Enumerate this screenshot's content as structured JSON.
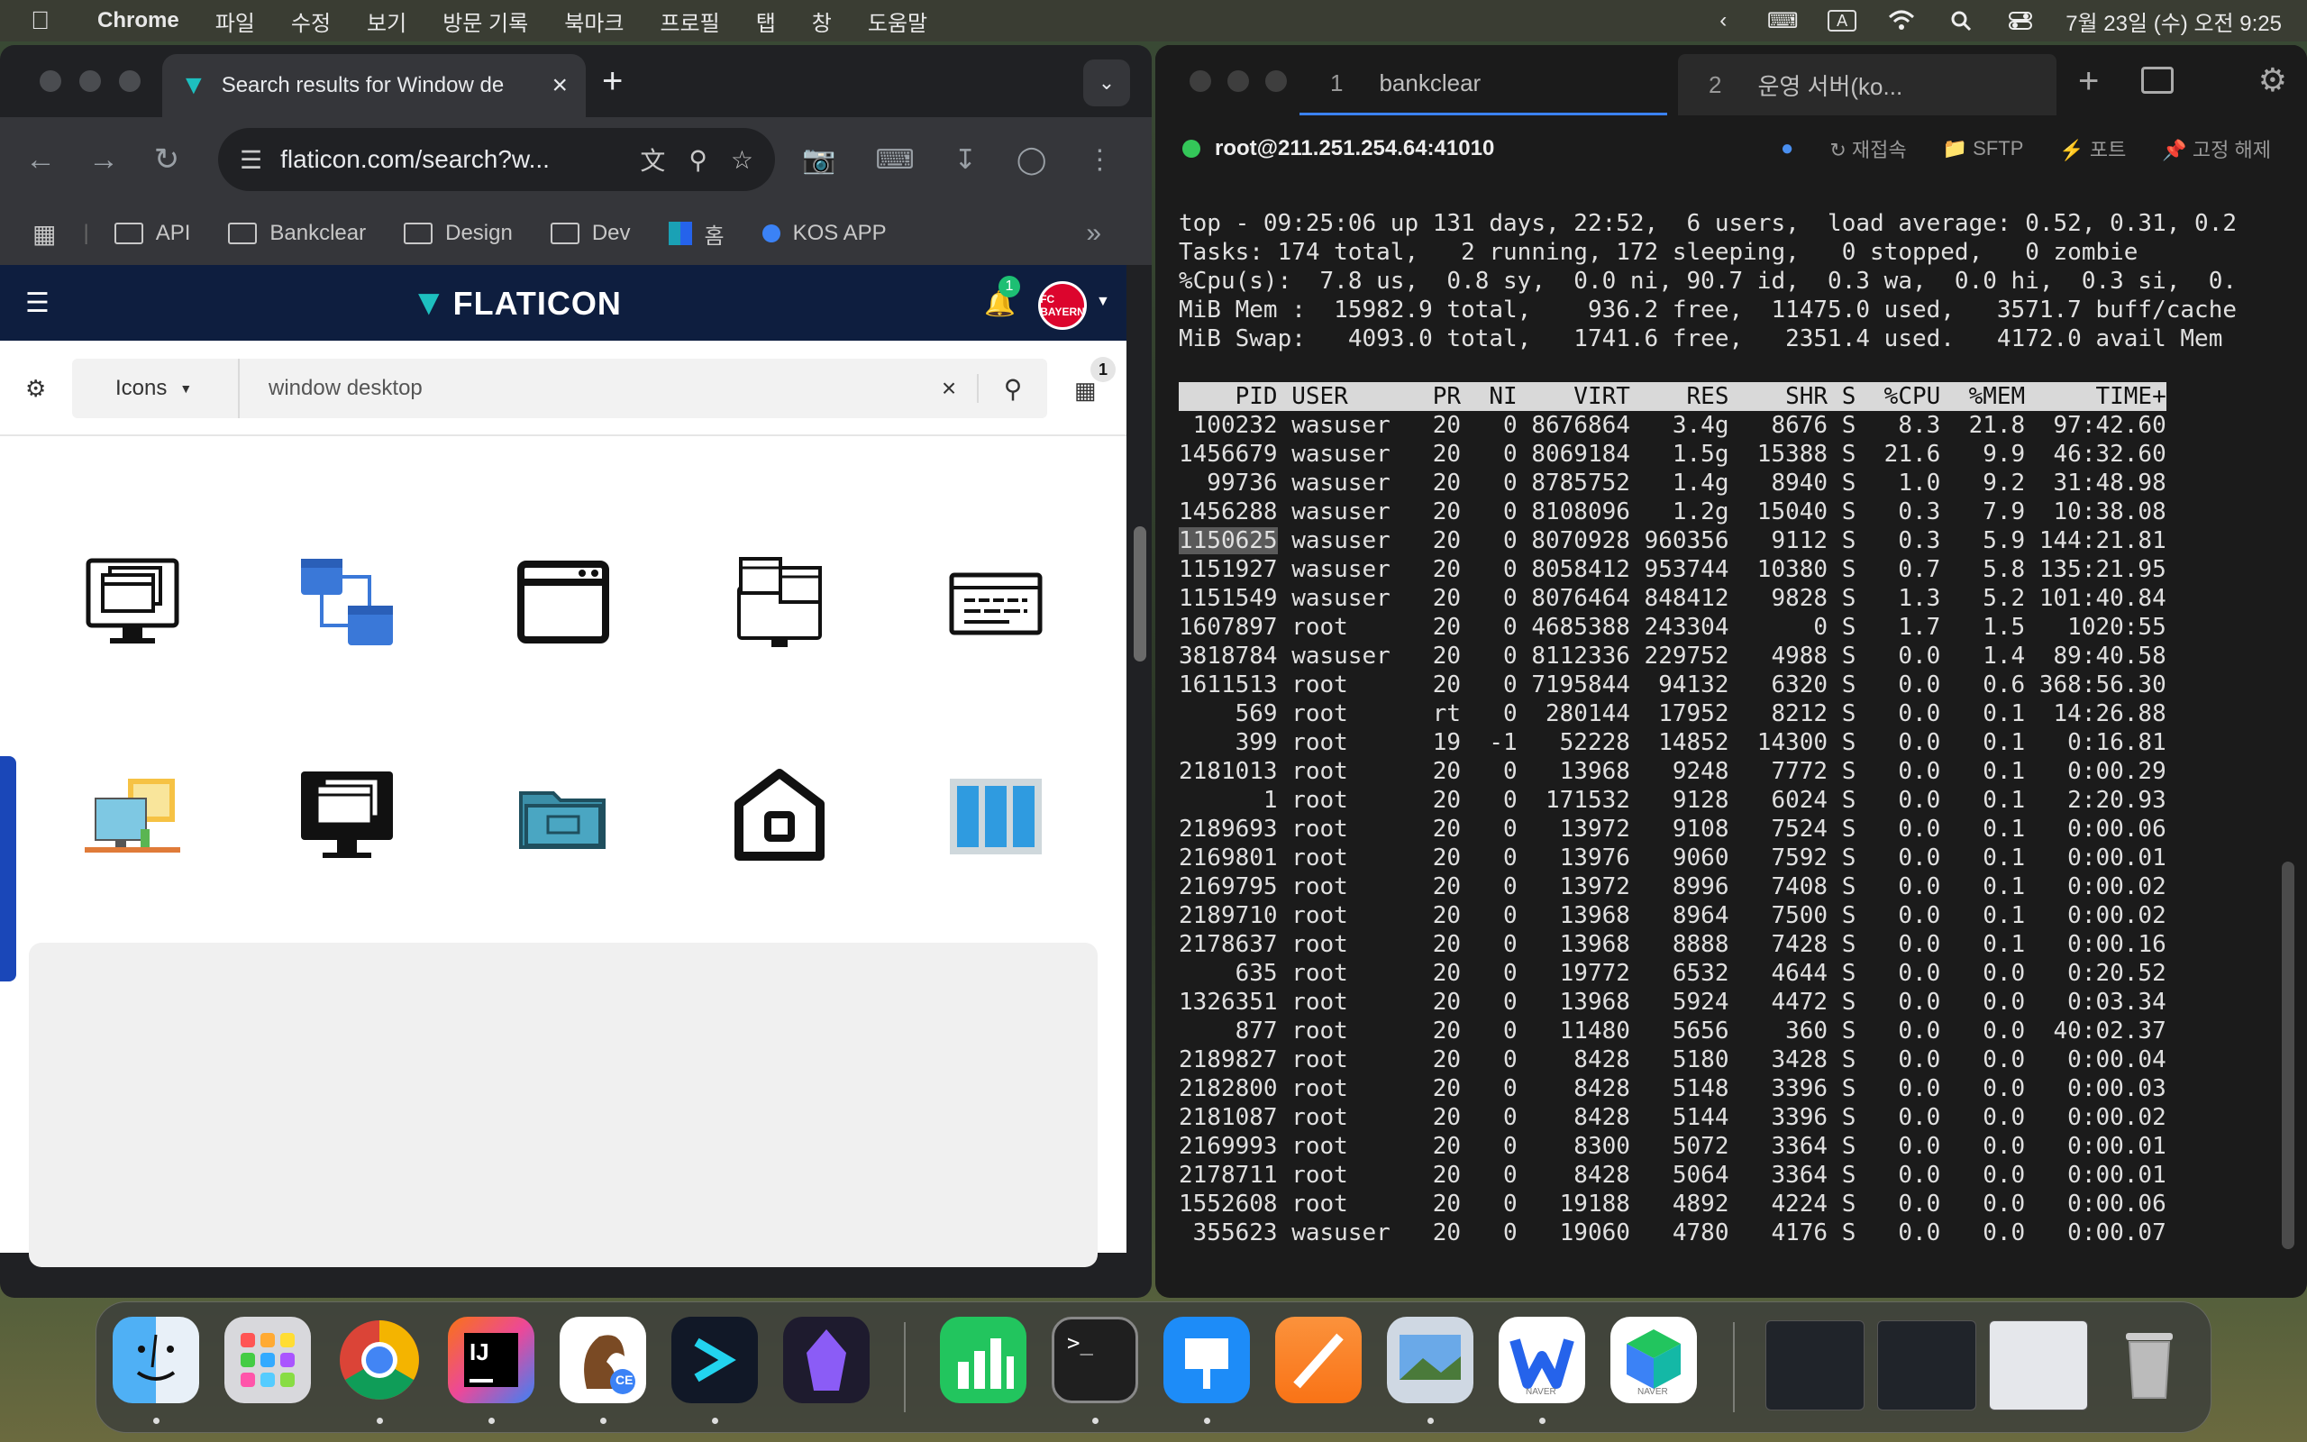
{
  "menubar": {
    "app_name": "Chrome",
    "items": [
      "파일",
      "수정",
      "보기",
      "방문 기록",
      "북마크",
      "프로필",
      "탭",
      "창",
      "도움말"
    ],
    "clock": "7월 23일 (수) 오전 9:25",
    "input_indicator": "A"
  },
  "browser": {
    "tab_title": "Search results for Window de",
    "url": "flaticon.com/search?w...",
    "bookmarks": [
      "API",
      "Bankclear",
      "Design",
      "Dev",
      "홈",
      "KOS APP"
    ]
  },
  "flaticon": {
    "logo_text": "FLATICON",
    "notification_count": "1",
    "avatar_text": "FC BAYERN",
    "category": "Icons",
    "search_query": "window desktop",
    "collection_count": "1",
    "icons": [
      "monitor-windows-icon",
      "network-windows-icon",
      "browser-window-icon",
      "computer-windows-icon",
      "webpage-lines-icon",
      "desk-monitor-icon",
      "dark-monitor-icon",
      "folder-window-icon",
      "home-window-icon",
      "window-columns-icon"
    ]
  },
  "terminal": {
    "tabs": [
      {
        "num": "1",
        "label": "bankclear"
      },
      {
        "num": "2",
        "label": "운영 서버(ko..."
      }
    ],
    "host": "root@211.251.254.64:41010",
    "actions": [
      "재접속",
      "SFTP",
      "포트",
      "고정 해제"
    ],
    "summary": [
      "top - 09:25:06 up 131 days, 22:52,  6 users,  load average: 0.52, 0.31, 0.2",
      "Tasks: 174 total,   2 running, 172 sleeping,   0 stopped,   0 zombie",
      "%Cpu(s):  7.8 us,  0.8 sy,  0.0 ni, 90.7 id,  0.3 wa,  0.0 hi,  0.3 si,  0.",
      "MiB Mem :  15982.9 total,    936.2 free,  11475.0 used,   3571.7 buff/cache",
      "MiB Swap:   4093.0 total,   1741.6 free,   2351.4 used.   4172.0 avail Mem"
    ],
    "header": "    PID USER      PR  NI    VIRT    RES    SHR S  %CPU  %MEM     TIME+",
    "selected_pid": "1150625",
    "rows": [
      " 100232 wasuser   20   0 8676864   3.4g   8676 S   8.3  21.8  97:42.60",
      "1456679 wasuser   20   0 8069184   1.5g  15388 S  21.6   9.9  46:32.60",
      "  99736 wasuser   20   0 8785752   1.4g   8940 S   1.0   9.2  31:48.98",
      "1456288 wasuser   20   0 8108096   1.2g  15040 S   0.3   7.9  10:38.08",
      "1150625 wasuser   20   0 8070928 960356   9112 S   0.3   5.9 144:21.81",
      "1151927 wasuser   20   0 8058412 953744  10380 S   0.7   5.8 135:21.95",
      "1151549 wasuser   20   0 8076464 848412   9828 S   1.3   5.2 101:40.84",
      "1607897 root      20   0 4685388 243304      0 S   1.7   1.5   1020:55",
      "3818784 wasuser   20   0 8112336 229752   4988 S   0.0   1.4  89:40.58",
      "1611513 root      20   0 7195844  94132   6320 S   0.0   0.6 368:56.30",
      "    569 root      rt   0  280144  17952   8212 S   0.0   0.1  14:26.88",
      "    399 root      19  -1   52228  14852  14300 S   0.0   0.1   0:16.81",
      "2181013 root      20   0   13968   9248   7772 S   0.0   0.1   0:00.29",
      "      1 root      20   0  171532   9128   6024 S   0.0   0.1   2:20.93",
      "2189693 root      20   0   13972   9108   7524 S   0.0   0.1   0:00.06",
      "2169801 root      20   0   13976   9060   7592 S   0.0   0.1   0:00.01",
      "2169795 root      20   0   13972   8996   7408 S   0.0   0.1   0:00.02",
      "2189710 root      20   0   13968   8964   7500 S   0.0   0.1   0:00.02",
      "2178637 root      20   0   13968   8888   7428 S   0.0   0.1   0:00.16",
      "    635 root      20   0   19772   6532   4644 S   0.0   0.0   0:20.52",
      "1326351 root      20   0   13968   5924   4472 S   0.0   0.0   0:03.34",
      "    877 root      20   0   11480   5656    360 S   0.0   0.0  40:02.37",
      "2189827 root      20   0    8428   5180   3428 S   0.0   0.0   0:00.04",
      "2182800 root      20   0    8428   5148   3396 S   0.0   0.0   0:00.03",
      "2181087 root      20   0    8428   5144   3396 S   0.0   0.0   0:00.02",
      "2169993 root      20   0    8300   5072   3364 S   0.0   0.0   0:00.01",
      "2178711 root      20   0    8428   5064   3364 S   0.0   0.0   0:00.01",
      "1552608 root      20   0   19188   4892   4224 S   0.0   0.0   0:00.06",
      " 355623 wasuser   20   0   19060   4780   4176 S   0.0   0.0   0:00.07"
    ]
  },
  "dock": {
    "apps": [
      "Finder",
      "Launchpad",
      "Chrome",
      "IntelliJ IDEA CE",
      "Sequel Ace",
      "Termius",
      "Obsidian",
      "Numbers",
      "Terminal",
      "Keynote",
      "Pages",
      "Preview",
      "Naver Whale",
      "Naver"
    ],
    "labels": {
      "intellij_badge": "CE",
      "whale_label": "NAVER",
      "naver_label": "NAVER",
      "terminal_prompt": ">_"
    }
  }
}
